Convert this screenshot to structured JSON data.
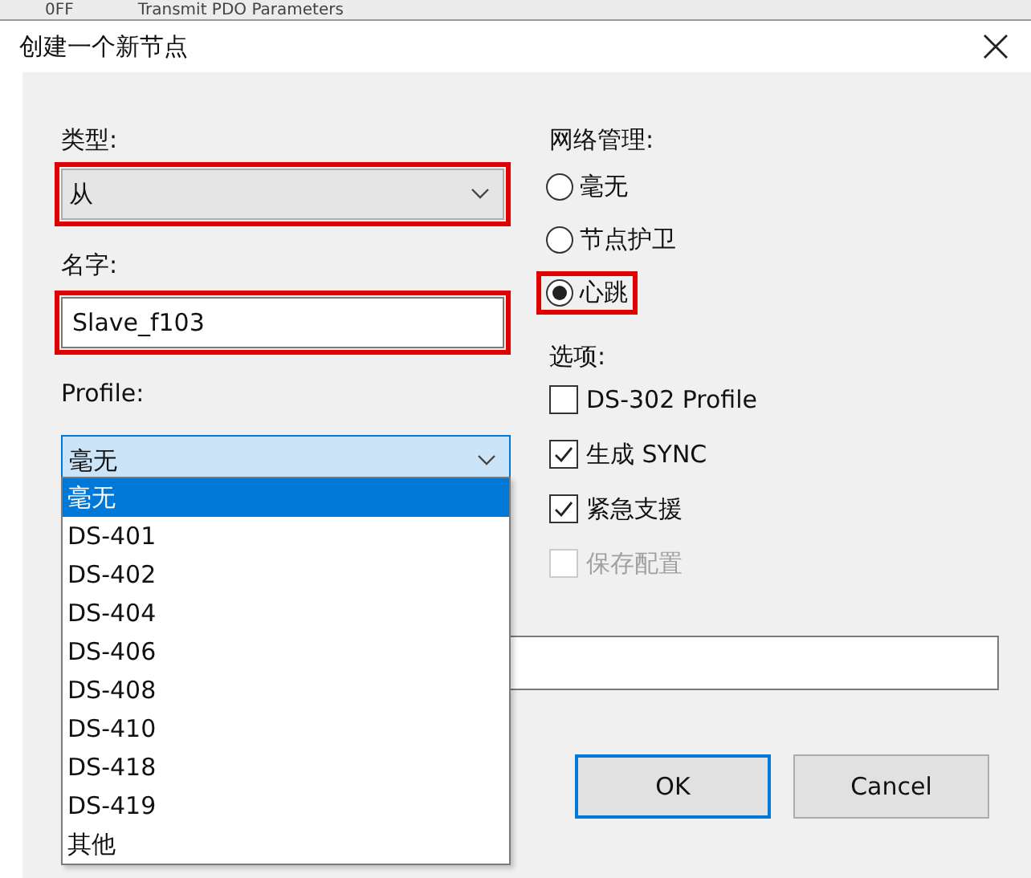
{
  "background_window": {
    "texts": [
      "0FF",
      "Transmit PDO Parameters"
    ]
  },
  "dialog": {
    "title": "创建一个新节点"
  },
  "type": {
    "label": "类型:",
    "value": "从",
    "highlighted": true
  },
  "name": {
    "label": "名字:",
    "value": "Slave_f103",
    "highlighted": true
  },
  "profile": {
    "label": "Profile:",
    "value": "毫无",
    "open": true,
    "options": [
      {
        "label": "毫无",
        "selected": true
      },
      {
        "label": "DS-401",
        "selected": false
      },
      {
        "label": "DS-402",
        "selected": false
      },
      {
        "label": "DS-404",
        "selected": false
      },
      {
        "label": "DS-406",
        "selected": false
      },
      {
        "label": "DS-408",
        "selected": false
      },
      {
        "label": "DS-410",
        "selected": false
      },
      {
        "label": "DS-418",
        "selected": false
      },
      {
        "label": "DS-419",
        "selected": false
      },
      {
        "label": "其他",
        "selected": false
      }
    ]
  },
  "network_management": {
    "label": "网络管理:",
    "options": [
      {
        "label": "毫无",
        "selected": false,
        "highlighted": false
      },
      {
        "label": "节点护卫",
        "selected": false,
        "highlighted": false
      },
      {
        "label": "心跳",
        "selected": true,
        "highlighted": true
      }
    ]
  },
  "options": {
    "label": "选项:",
    "items": [
      {
        "label": "DS-302 Profile",
        "checked": false,
        "disabled": false
      },
      {
        "label": "生成 SYNC",
        "checked": true,
        "disabled": false
      },
      {
        "label": "紧急支援",
        "checked": true,
        "disabled": false
      },
      {
        "label": "保存配置",
        "checked": false,
        "disabled": true
      }
    ]
  },
  "buttons": [
    {
      "label": "OK",
      "default": true
    },
    {
      "label": "Cancel",
      "default": false
    }
  ]
}
